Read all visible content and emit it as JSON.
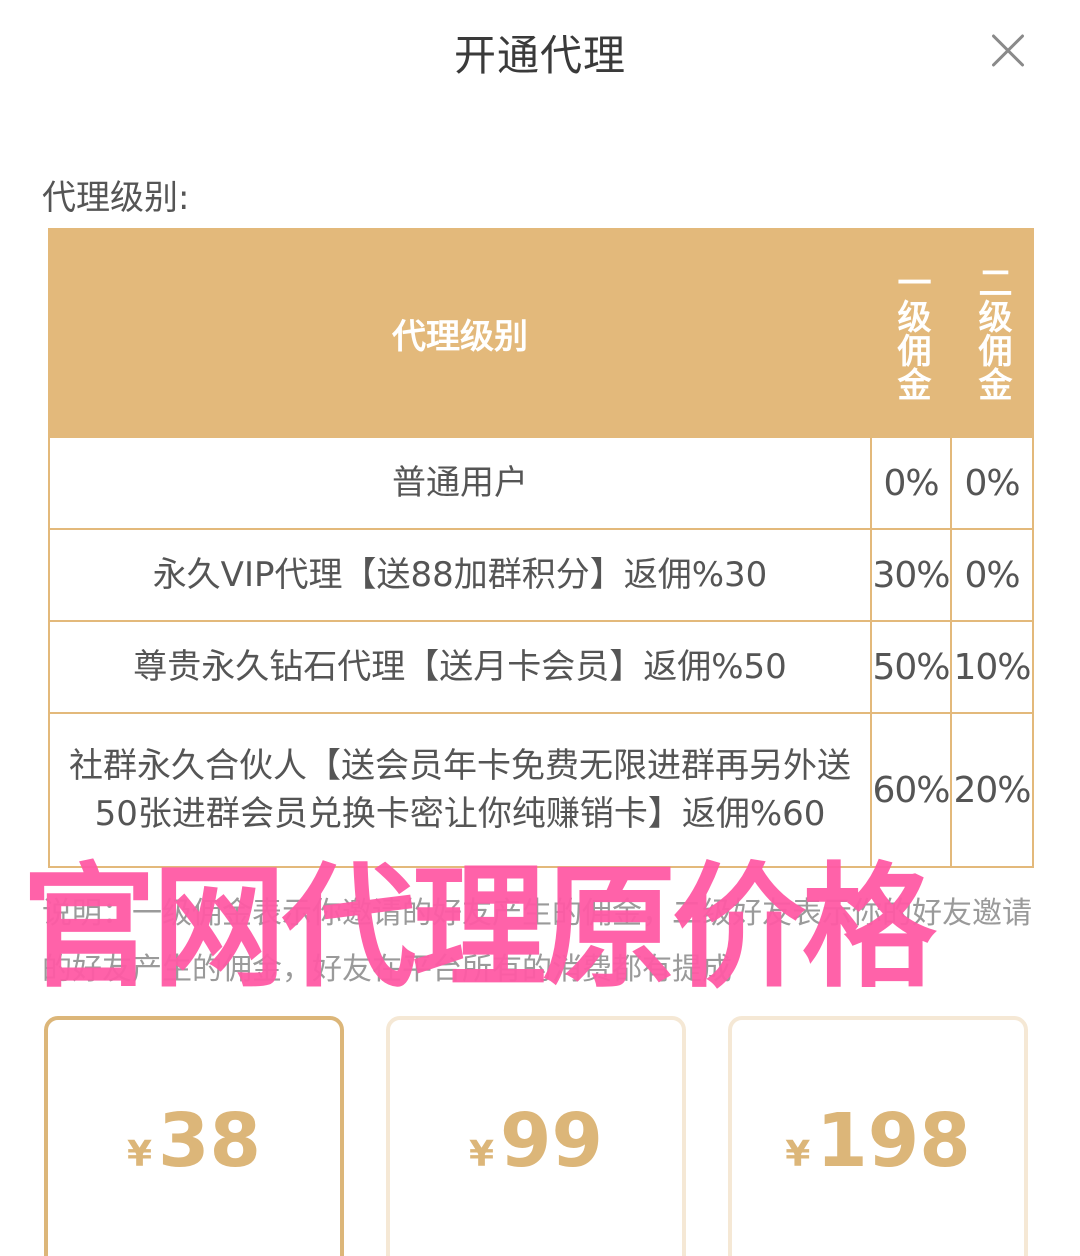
{
  "header": {
    "title": "开通代理"
  },
  "section": {
    "label": "代理级别:"
  },
  "table": {
    "headers": {
      "level": "代理级别",
      "level1_commission": "一级佣金",
      "level2_commission": "二级佣金"
    },
    "rows": [
      {
        "name": "普通用户",
        "level1": "0%",
        "level2": "0%"
      },
      {
        "name": "永久VIP代理【送88加群积分】返佣%30",
        "level1": "30%",
        "level2": "0%"
      },
      {
        "name": "尊贵永久钻石代理【送月卡会员】返佣%50",
        "level1": "50%",
        "level2": "10%"
      },
      {
        "name": "社群永久合伙人【送会员年卡免费无限进群再另外送50张进群会员兑换卡密让你纯赚销卡】返佣%60",
        "level1": "60%",
        "level2": "20%"
      }
    ]
  },
  "note": {
    "text": "说明：一级佣金表示你邀请的好友产生的佣金，二级好友表示你的好友邀请的好友产生的佣金，好友在平台所有的消费都有提成"
  },
  "watermark": {
    "text": "官网代理原价格"
  },
  "prices": [
    {
      "currency": "¥",
      "amount": "38",
      "selected": true
    },
    {
      "currency": "¥",
      "amount": "99",
      "selected": false
    },
    {
      "currency": "¥",
      "amount": "198",
      "selected": false
    }
  ],
  "colors": {
    "accent": "#e3b97b",
    "price": "#dcb679",
    "watermark": "#ff5aa5"
  }
}
